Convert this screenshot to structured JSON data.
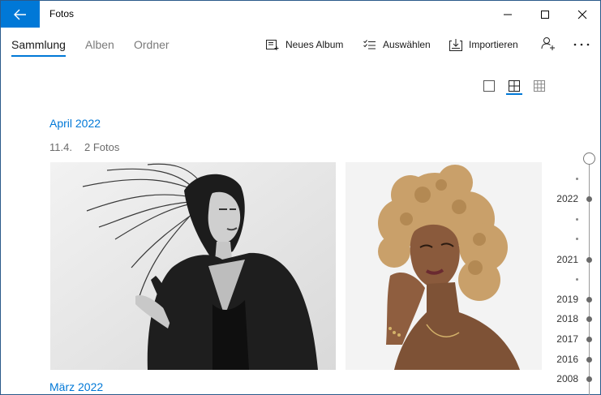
{
  "window": {
    "title": "Fotos"
  },
  "nav": {
    "tabs": [
      {
        "label": "Sammlung",
        "active": true
      },
      {
        "label": "Alben",
        "active": false
      },
      {
        "label": "Ordner",
        "active": false
      }
    ]
  },
  "toolbar": {
    "new_album": "Neues Album",
    "select": "Auswählen",
    "import": "Importieren"
  },
  "content": {
    "groups": [
      {
        "month": "April 2022",
        "day": "11.4.",
        "count": "2 Fotos"
      },
      {
        "month": "März 2022"
      }
    ]
  },
  "timeline": {
    "years": [
      "2022",
      "2021",
      "2019",
      "2018",
      "2017",
      "2016",
      "2008"
    ]
  },
  "colors": {
    "accent": "#0078d7"
  }
}
